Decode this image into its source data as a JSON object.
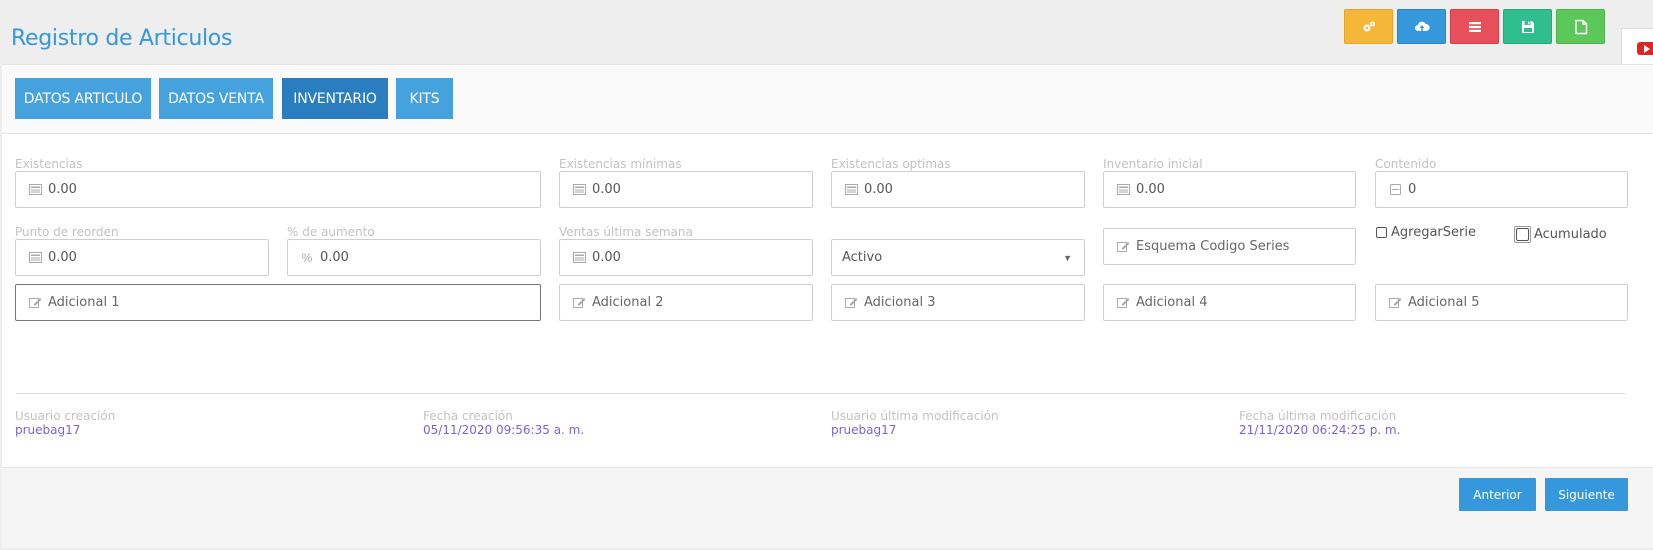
{
  "header": {
    "title": "Registro de Articulos"
  },
  "toolbar": {
    "buttons": [
      {
        "name": "settings",
        "color": "#f4b73a",
        "icon": "cogs-icon"
      },
      {
        "name": "cloud",
        "color": "#3598dc",
        "icon": "cloud-upload-icon"
      },
      {
        "name": "list",
        "color": "#e7505a",
        "icon": "list-icon"
      },
      {
        "name": "save",
        "color": "#2fbf8f",
        "icon": "floppy-icon"
      },
      {
        "name": "new",
        "color": "#5cc85a",
        "icon": "file-icon"
      }
    ]
  },
  "tabs": [
    {
      "label": "DATOS ARTICULO",
      "active": false
    },
    {
      "label": "DATOS VENTA",
      "active": false
    },
    {
      "label": "INVENTARIO",
      "active": true
    },
    {
      "label": "KITS",
      "active": false
    }
  ],
  "fields": {
    "existencias": {
      "label": "Existencias",
      "value": "0.00"
    },
    "existencias_minimas": {
      "label": "Existencias mínimas",
      "value": "0.00"
    },
    "existencias_optimas": {
      "label": "Existencias optimas",
      "value": "0.00"
    },
    "inventario_inicial": {
      "label": "Inventario inicial",
      "value": "0.00"
    },
    "contenido": {
      "label": "Contenido",
      "value": "0"
    },
    "punto_reorden": {
      "label": "Punto de reorden",
      "value": "0.00"
    },
    "aumento": {
      "label": "% de aumento",
      "value": "0.00",
      "prefix": "%"
    },
    "ventas_semana": {
      "label": "Ventas última semana",
      "value": "0.00"
    },
    "estado": {
      "value": "Activo"
    },
    "esquema_series": {
      "placeholder": "Esquema Codigo Series"
    },
    "agregar_serie": {
      "label": "AgregarSerie",
      "checked": false
    },
    "acumulado": {
      "label": "Acumulado",
      "checked": false
    },
    "adicional_1": {
      "placeholder": "Adicional 1"
    },
    "adicional_2": {
      "placeholder": "Adicional 2"
    },
    "adicional_3": {
      "placeholder": "Adicional 3"
    },
    "adicional_4": {
      "placeholder": "Adicional 4"
    },
    "adicional_5": {
      "placeholder": "Adicional 5"
    }
  },
  "audit": {
    "usuario_creacion": {
      "label": "Usuario creación",
      "value": "pruebag17"
    },
    "fecha_creacion": {
      "label": "Fecha creación",
      "value": "05/11/2020 09:56:35 a. m."
    },
    "usuario_modificacion": {
      "label": "Usuario última modificación",
      "value": "pruebag17"
    },
    "fecha_modificacion": {
      "label": "Fecha última modificación",
      "value": "21/11/2020 06:24:25 p. m."
    }
  },
  "footer": {
    "prev_label": "Anterior",
    "next_label": "Siguiente"
  },
  "colors": {
    "primary": "#3598dc",
    "active_tab": "#2a7ec0",
    "title": "#3498db",
    "audit_value": "#7c62d8"
  }
}
